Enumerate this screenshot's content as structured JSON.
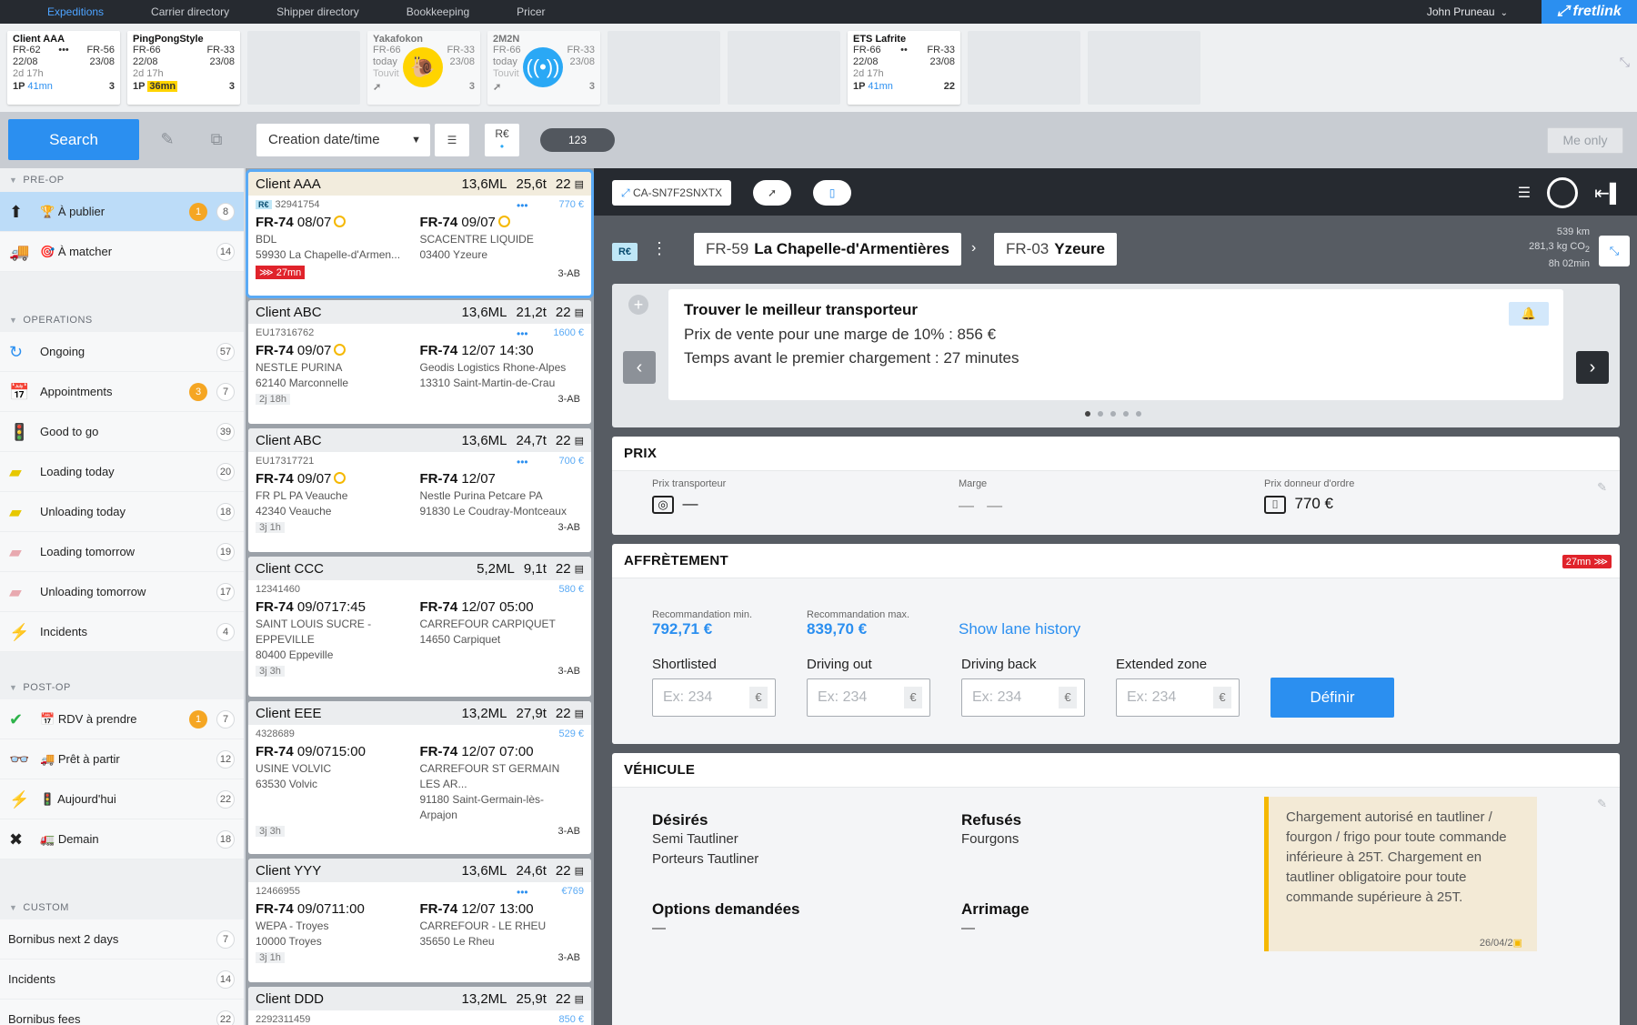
{
  "nav": {
    "tabs": [
      "Expeditions",
      "Carrier directory",
      "Shipper directory",
      "Bookkeeping",
      "Pricer"
    ],
    "active": 0,
    "user": "John Pruneau",
    "brand": "fretlink"
  },
  "cards": [
    {
      "title": "Client AAA",
      "from": "FR-62",
      "to": "FR-56",
      "fromDate": "22/08",
      "toDate": "23/08",
      "dur": "2d 17h",
      "p": "1P",
      "time": "41mn",
      "count": "3",
      "hl": false
    },
    {
      "title": "PingPongStyle",
      "from": "FR-66",
      "to": "FR-33",
      "fromDate": "22/08",
      "toDate": "23/08",
      "dur": "2d 17h",
      "p": "1P",
      "time": "36mn",
      "count": "3",
      "hl": true
    },
    {
      "title": "Yakafokon",
      "from": "FR-66",
      "to": "FR-33",
      "fromDate": "today",
      "toDate": "23/08",
      "dur": "Touvit",
      "p": "",
      "time": "",
      "count": "3",
      "hl": false
    },
    {
      "title": "2M2N",
      "from": "FR-66",
      "to": "FR-33",
      "fromDate": "today",
      "toDate": "23/08",
      "dur": "Touvit",
      "p": "",
      "time": "",
      "count": "3",
      "hl": false
    },
    {
      "title": "ETS Lafrite",
      "from": "FR-66",
      "to": "FR-33",
      "fromDate": "22/08",
      "toDate": "23/08",
      "dur": "2d 17h",
      "p": "1P",
      "time": "41mn",
      "count": "22",
      "hl": false
    }
  ],
  "toolbar": {
    "search": "Search",
    "sort": "Creation date/time",
    "rc": "R€",
    "count": "123",
    "meonly": "Me only"
  },
  "sidebar": {
    "preop": "PRE-OP",
    "operations": "OPERATIONS",
    "postop": "POST-OP",
    "custom": "CUSTOM",
    "pre": [
      {
        "label": "À publier",
        "count": "8",
        "alert": "1"
      },
      {
        "label": "À matcher",
        "count": "14",
        "alert": ""
      }
    ],
    "ops": [
      {
        "label": "Ongoing",
        "count": "57",
        "alert": ""
      },
      {
        "label": "Appointments",
        "count": "7",
        "alert": "3"
      },
      {
        "label": "Good to go",
        "count": "39",
        "alert": ""
      },
      {
        "label": "Loading today",
        "count": "20",
        "alert": ""
      },
      {
        "label": "Unloading today",
        "count": "18",
        "alert": ""
      },
      {
        "label": "Loading tomorrow",
        "count": "19",
        "alert": ""
      },
      {
        "label": "Unloading tomorrow",
        "count": "17",
        "alert": ""
      },
      {
        "label": "Incidents",
        "count": "4",
        "alert": ""
      }
    ],
    "post": [
      {
        "label": "RDV à prendre",
        "count": "7",
        "alert": "1"
      },
      {
        "label": "Prêt à partir",
        "count": "12",
        "alert": ""
      },
      {
        "label": "Aujourd'hui",
        "count": "22",
        "alert": ""
      },
      {
        "label": "Demain",
        "count": "18",
        "alert": ""
      }
    ],
    "customItems": [
      {
        "label": "Bornibus next 2 days",
        "count": "7"
      },
      {
        "label": "Incidents",
        "count": "14"
      },
      {
        "label": "Bornibus fees",
        "count": "22"
      }
    ]
  },
  "list": [
    {
      "client": "Client AAA",
      "ml": "13,6ML",
      "t": "25,6t",
      "n": "22",
      "ref": "32941754",
      "price": "770 €",
      "d1": "FR-74",
      "date1": "08/07",
      "o1": "BDL",
      "o2": "59930 La Chapelle-d'Armen...",
      "d2": "FR-74",
      "date2": "09/07",
      "a1": "SCACENTRE LIQUIDE",
      "a2": "03400 Yzeure",
      "dur": "",
      "red": "27mn",
      "tag": "3-AB"
    },
    {
      "client": "Client ABC",
      "ml": "13,6ML",
      "t": "21,2t",
      "n": "22",
      "ref": "EU17316762",
      "price": "1600 €",
      "d1": "FR-74",
      "date1": "09/07",
      "o1": "NESTLE PURINA",
      "o2": "62140 Marconnelle",
      "d2": "FR-74",
      "date2": "12/07 14:30",
      "a1": "Geodis Logistics Rhone-Alpes",
      "a2": "13310 Saint-Martin-de-Crau",
      "dur": "2j 18h",
      "red": "",
      "tag": "3-AB"
    },
    {
      "client": "Client ABC",
      "ml": "13,6ML",
      "t": "24,7t",
      "n": "22",
      "ref": "EU17317721",
      "price": "700 €",
      "d1": "FR-74",
      "date1": "09/07",
      "o1": "FR PL PA Veauche",
      "o2": "42340 Veauche",
      "d2": "FR-74",
      "date2": "12/07",
      "a1": "Nestle Purina Petcare PA",
      "a2": "91830 Le Coudray-Montceaux",
      "dur": "3j 1h",
      "red": "",
      "tag": "3-AB"
    },
    {
      "client": "Client CCC",
      "ml": "5,2ML",
      "t": "9,1t",
      "n": "22",
      "ref": "12341460",
      "price": "580 €",
      "d1": "FR-74",
      "date1": "09/07",
      "time1": "17:45",
      "o1": "SAINT LOUIS SUCRE -",
      "o1b": "EPPEVILLE",
      "o2": "80400 Eppeville",
      "d2": "FR-74",
      "date2": "12/07",
      "time2": "05:00",
      "a1": "CARREFOUR CARPIQUET",
      "a2": "14650 Carpiquet",
      "dur": "3j 3h",
      "red": "",
      "tag": "3-AB"
    },
    {
      "client": "Client EEE",
      "ml": "13,2ML",
      "t": "27,9t",
      "n": "22",
      "ref": "4328689",
      "price": "529 €",
      "d1": "FR-74",
      "date1": "09/07",
      "time1": "15:00",
      "o1": "USINE VOLVIC",
      "o2": "63530 Volvic",
      "d2": "FR-74",
      "date2": "12/07",
      "time2": "07:00",
      "a1": "CARREFOUR ST GERMAIN",
      "a1b": "LES AR...",
      "a2": "91180 Saint-Germain-lès-",
      "a2b": "Arpajon",
      "dur": "3j 3h",
      "red": "",
      "tag": "3-AB"
    },
    {
      "client": "Client YYY",
      "ml": "13,6ML",
      "t": "24,6t",
      "n": "22",
      "ref": "12466955",
      "price": "€769",
      "d1": "FR-74",
      "date1": "09/07",
      "time1": "11:00",
      "o1": "WEPA - Troyes",
      "o2": "10000 Troyes",
      "d2": "FR-74",
      "date2": "12/07",
      "time2": "13:00",
      "a1": "CARREFOUR - LE RHEU",
      "a2": "35650 Le Rheu",
      "dur": "3j 1h",
      "red": "",
      "tag": "3-AB"
    },
    {
      "client": "Client DDD",
      "ml": "13,2ML",
      "t": "25,9t",
      "n": "22",
      "ref": "2292311459",
      "price": "850 €"
    }
  ],
  "detail": {
    "code": "CA-SN7F2SNXTX",
    "rc": "R€",
    "from": {
      "dep": "FR-59",
      "city": "La Chapelle-d'Armentières"
    },
    "to": {
      "dep": "FR-03",
      "city": "Yzeure"
    },
    "km": "539 km",
    "co2": "281,3 kg CO",
    "co2sub": "2",
    "time": "8h 02min",
    "carousel": {
      "title": "Trouver le meilleur transporteur",
      "line1": "Prix de vente pour une marge de 10% : 856 €",
      "line2": "Temps avant le premier chargement : 27 minutes"
    },
    "prix": {
      "title": "PRIX",
      "carrier_lbl": "Prix transporteur",
      "carrier_val": "—",
      "margin_lbl": "Marge",
      "margin_val": "—   —",
      "shipper_lbl": "Prix donneur d'ordre",
      "shipper_val": "770 €"
    },
    "affr": {
      "title": "AFFRÈTEMENT",
      "badge": "27mn",
      "rec_min_lbl": "Recommandation min.",
      "rec_min": "792,71 €",
      "rec_max_lbl": "Recommandation max.",
      "rec_max": "839,70 €",
      "history": "Show lane history",
      "fields": [
        "Shortlisted",
        "Driving out",
        "Driving back",
        "Extended zone"
      ],
      "placeholder": "Ex: 234",
      "eur": "€",
      "define": "Définir"
    },
    "vehicule": {
      "title": "VÉHICULE",
      "desired_lbl": "Désirés",
      "desired": [
        "Semi Tautliner",
        "Porteurs Tautliner"
      ],
      "refused_lbl": "Refusés",
      "refused": [
        "Fourgons"
      ],
      "options_lbl": "Options demandées",
      "options_val": "—",
      "arrimage_lbl": "Arrimage",
      "arrimage_val": "—",
      "note": "Chargement autorisé en tautliner / fourgon / frigo pour toute commande inférieure à 25T. Chargement en tautliner obligatoire pour toute commande supérieure à 25T.",
      "note_date": "26/04/2"
    }
  },
  "colors": {
    "accent": "#2b8ff0",
    "alert": "#f5a623",
    "danger": "#e0232b"
  }
}
